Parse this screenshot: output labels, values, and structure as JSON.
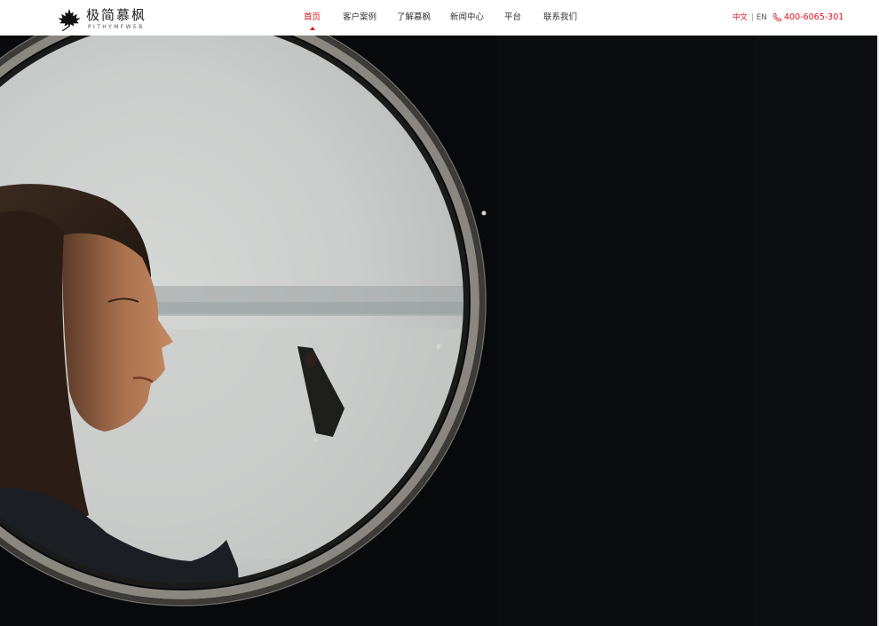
{
  "header": {
    "logo": {
      "name_cn": "极简慕枫",
      "name_en": "PITHYMFWEB",
      "icon": "maple-leaf-icon"
    },
    "nav": [
      {
        "label": "首页",
        "active": true
      },
      {
        "label": "客户案例",
        "active": false
      },
      {
        "label": "了解慕枫",
        "active": false
      },
      {
        "label": "新闻中心",
        "active": false
      },
      {
        "label": "平台",
        "active": false
      },
      {
        "label": "联系我们",
        "active": false
      }
    ],
    "lang": {
      "cn": "中文",
      "separator": "|",
      "en": "EN"
    },
    "phone": {
      "icon": "phone-icon",
      "number": "400-6065-301"
    }
  },
  "colors": {
    "accent": "#e0121e",
    "hero_background": "#07090a",
    "header_background": "#ffffff"
  }
}
